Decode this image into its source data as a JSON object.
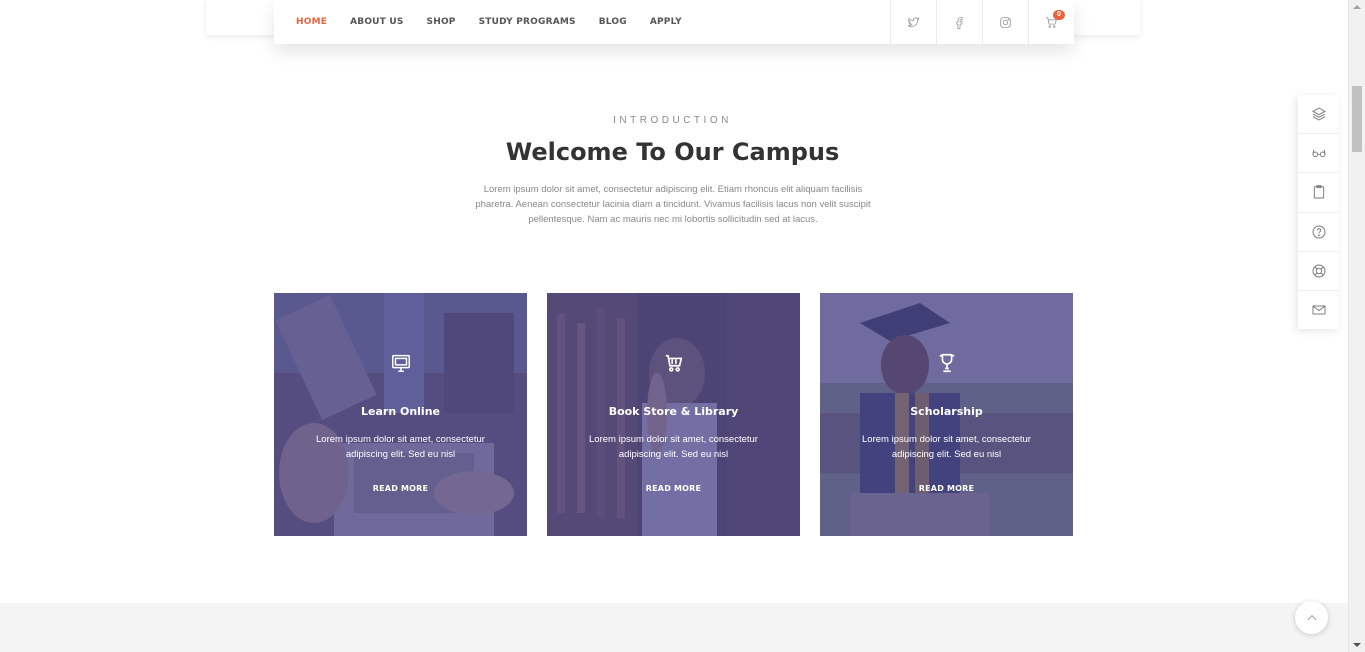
{
  "nav": {
    "links": [
      "HOME",
      "ABOUT US",
      "SHOP",
      "STUDY PROGRAMS",
      "BLOG",
      "APPLY"
    ],
    "active_index": 0,
    "cart_count": "0",
    "accent_color": "#e8643c"
  },
  "intro": {
    "eyebrow": "INTRODUCTION",
    "title": "Welcome To Our Campus",
    "text": "Lorem ipsum dolor sit amet, consectetur adipiscing elit. Etiam rhoncus elit aliquam facilisis pharetra. Aenean consectetur lacinia diam a tincidunt. Vivamus facilisis lacus non velit suscipit pellentesque. Nam ac mauris nec mi lobortis sollicitudin sed at lacus."
  },
  "cards": [
    {
      "icon": "monitor-icon",
      "title": "Learn Online",
      "text": "Lorem ipsum dolor sit amet, consectetur adipiscing elit. Sed eu nisl",
      "link": "READ MORE"
    },
    {
      "icon": "cart-icon",
      "title": "Book Store & Library",
      "text": "Lorem ipsum dolor sit amet, consectetur adipiscing elit. Sed eu nisl",
      "link": "READ MORE"
    },
    {
      "icon": "trophy-icon",
      "title": "Scholarship",
      "text": "Lorem ipsum dolor sit amet, consectetur adipiscing elit. Sed eu nisl",
      "link": "READ MORE"
    }
  ],
  "card_overlay_color": "#4c488c",
  "tools": [
    "layers-icon",
    "glasses-icon",
    "clipboard-icon",
    "help-icon",
    "lifebuoy-icon",
    "mail-icon"
  ]
}
